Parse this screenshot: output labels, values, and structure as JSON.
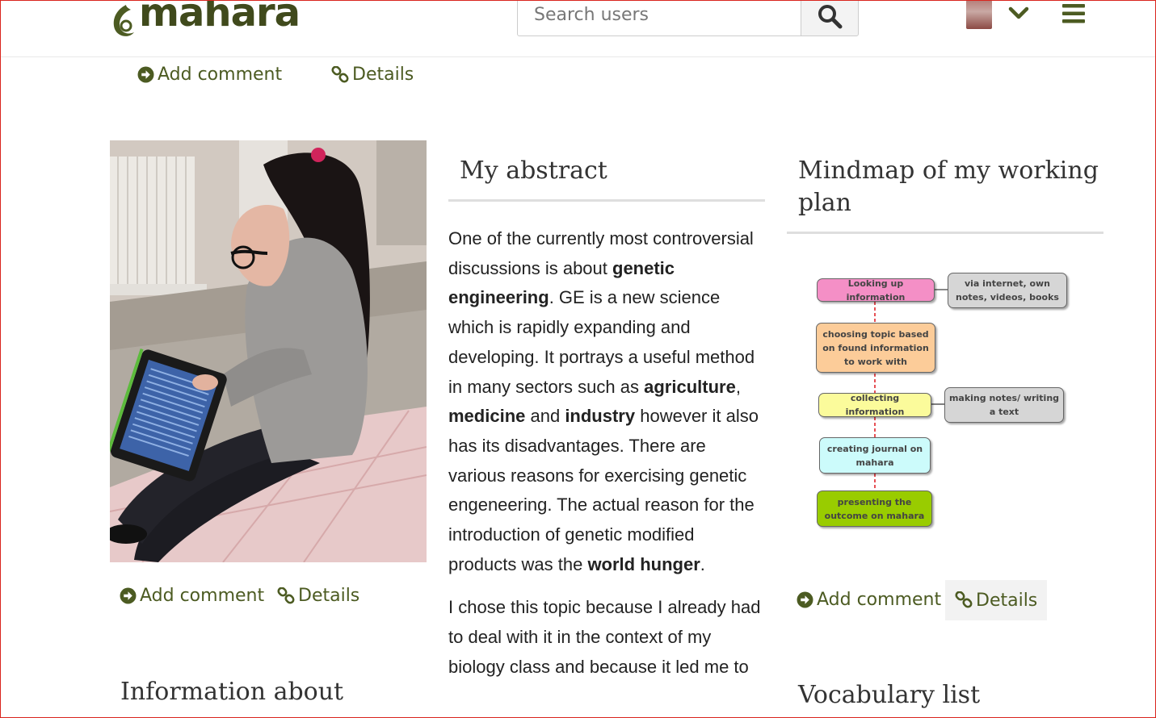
{
  "header": {
    "logo_text": "mahara",
    "search_placeholder": "Search users"
  },
  "actions": {
    "add_comment": "Add comment",
    "details": "Details"
  },
  "abstract": {
    "title": "My abstract",
    "p1": {
      "s1": "One of the currently most controversial discussions is about ",
      "b1": "genetic engineering",
      "s2": ". GE is a new science which is rapidly expanding and developing. It portrays a useful method in many sectors such as ",
      "b2": "agriculture",
      "s3": ", ",
      "b3": "medicine",
      "s4": " and ",
      "b4": "industry",
      "s5": " however it also has its disadvantages. There are various reasons for exercising genetic engeneering. The actual reason for the introduction of genetic modified products was the ",
      "b5": "world hunger",
      "s6": "."
    },
    "p2": "I chose this topic because I already had to deal with it in the context of my biology class and because it led me to"
  },
  "mindmap": {
    "title": "Mindmap of my working plan",
    "nodes": {
      "n1": "Looking up information",
      "n1b": "via internet, own notes, videos, books",
      "n2": "choosing topic based on found information to work with",
      "n3": "collecting information",
      "n3b": "making notes/ writing a text",
      "n4": "creating journal on mahara",
      "n5": "presenting the outcome on mahara"
    },
    "colors": {
      "pink": "#f48fc6",
      "orange": "#fccc99",
      "yellow": "#fbfb9b",
      "cyan": "#ccfbfb",
      "green": "#99cc00",
      "grey": "#d6d6d6",
      "connector": "#e0252b"
    }
  },
  "lower": {
    "info_title": "Information about",
    "vocab_title": "Vocabulary list"
  }
}
